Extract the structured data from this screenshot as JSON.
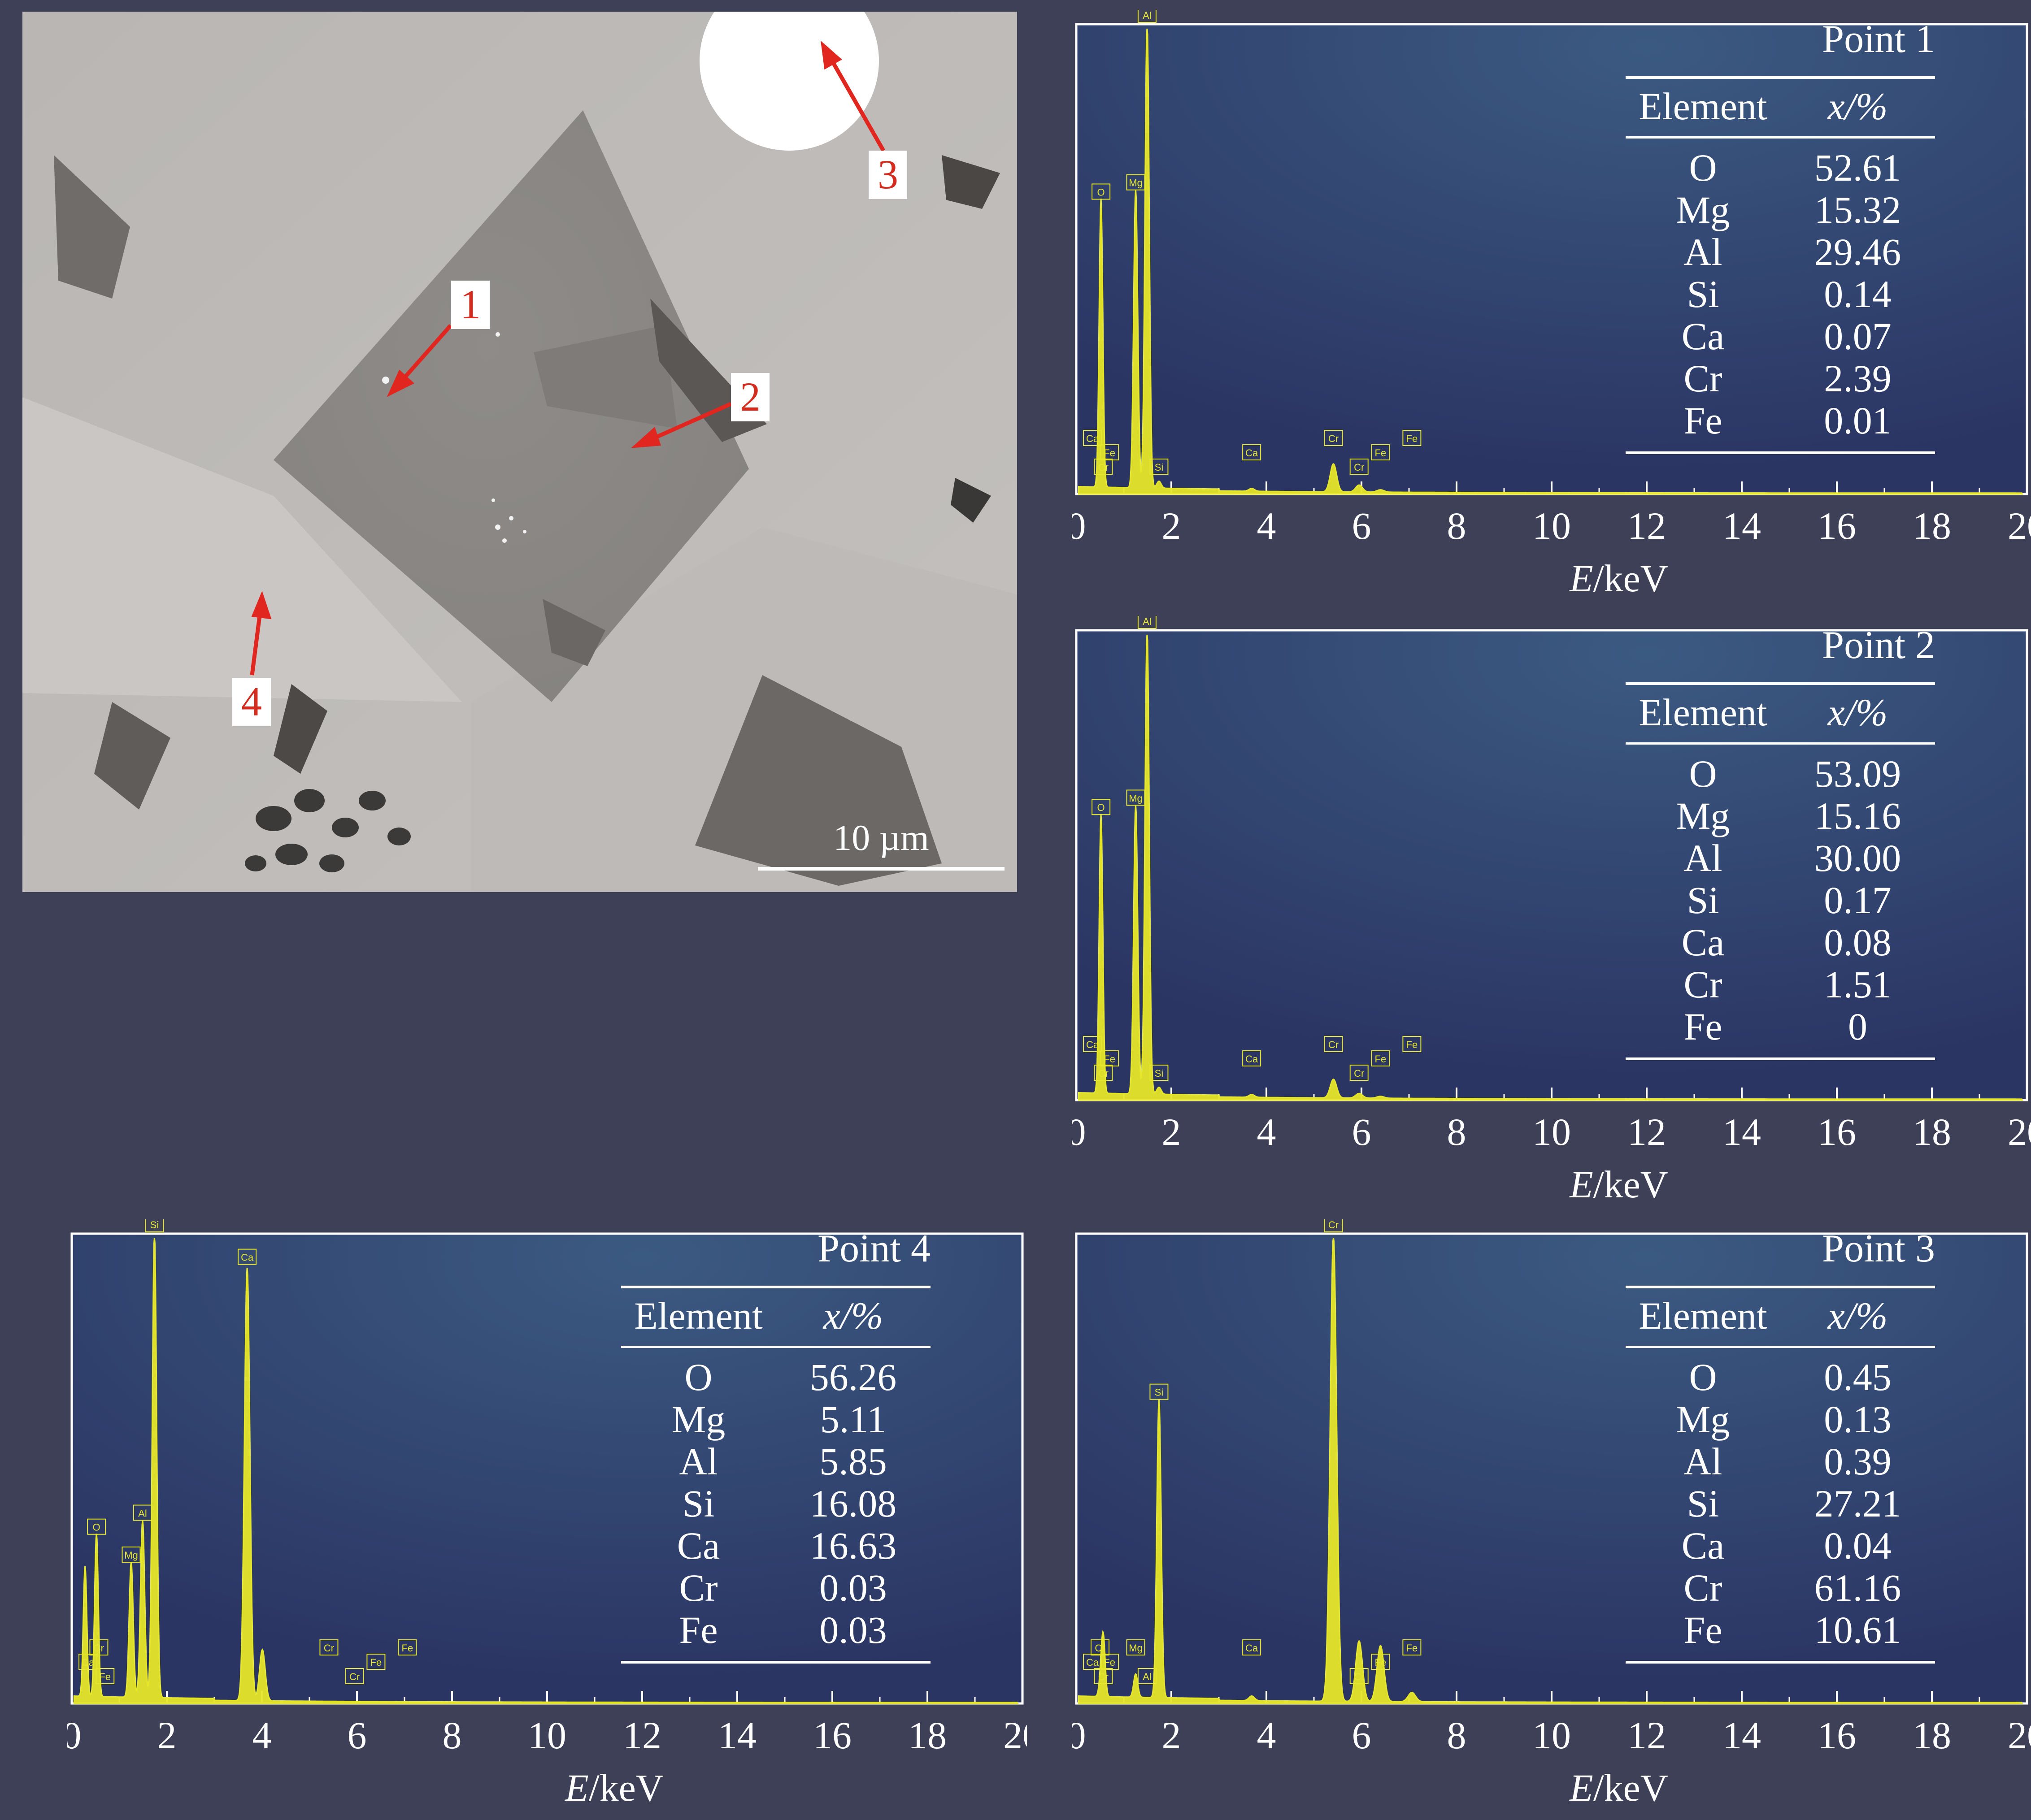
{
  "sem_image": {
    "scale_bar_label": "10 µm",
    "point_labels": [
      "1",
      "2",
      "3",
      "4"
    ]
  },
  "colors": {
    "background": "#3e4058",
    "spectrum": "#e6e62a",
    "axes": "#ffffff",
    "arrow": "#e0261e",
    "label_text": "#d42b1f"
  },
  "chart_data": [
    {
      "type": "line",
      "title": "Point 1",
      "xlabel": "E/keV",
      "xlim": [
        0,
        20
      ],
      "x_ticks": [
        "0",
        "2",
        "4",
        "6",
        "8",
        "10",
        "12",
        "14",
        "16",
        "18",
        "20"
      ],
      "peaks": [
        {
          "element": "O",
          "x": 0.52,
          "y": 62
        },
        {
          "element": "Mg",
          "x": 1.25,
          "y": 64
        },
        {
          "element": "Al",
          "x": 1.49,
          "y": 100
        },
        {
          "element": "Si",
          "x": 1.74,
          "y": 1.5
        },
        {
          "element": "Ca",
          "x": 3.69,
          "y": 0.6
        },
        {
          "element": "Cr",
          "x": 5.41,
          "y": 6
        },
        {
          "element": "Cr",
          "x": 5.95,
          "y": 1.5
        },
        {
          "element": "Fe",
          "x": 6.4,
          "y": 0.5
        }
      ],
      "peak_tags": [
        {
          "label": "Al",
          "x": 1.49
        },
        {
          "label": "Mg",
          "x": 1.25
        },
        {
          "label": "O",
          "x": 0.52
        },
        {
          "label": "Cr",
          "x": 0.57
        },
        {
          "label": "Fe",
          "x": 0.7
        },
        {
          "label": "Ca",
          "x": 0.34
        },
        {
          "label": "Si",
          "x": 1.74
        },
        {
          "label": "Ca",
          "x": 3.69
        },
        {
          "label": "Cr",
          "x": 5.41
        },
        {
          "label": "Cr",
          "x": 5.95
        },
        {
          "label": "Fe",
          "x": 6.4
        },
        {
          "label": "Fe",
          "x": 7.06
        }
      ],
      "table": {
        "headers": [
          "Element",
          "x/%"
        ],
        "rows": [
          [
            "O",
            "52.61"
          ],
          [
            "Mg",
            "15.32"
          ],
          [
            "Al",
            "29.46"
          ],
          [
            "Si",
            "0.14"
          ],
          [
            "Ca",
            "0.07"
          ],
          [
            "Cr",
            "2.39"
          ],
          [
            "Fe",
            "0.01"
          ]
        ]
      }
    },
    {
      "type": "line",
      "title": "Point 2",
      "xlabel": "E/keV",
      "xlim": [
        0,
        20
      ],
      "x_ticks": [
        "0",
        "2",
        "4",
        "6",
        "8",
        "10",
        "12",
        "14",
        "16",
        "18",
        "20"
      ],
      "peaks": [
        {
          "element": "O",
          "x": 0.52,
          "y": 60
        },
        {
          "element": "Mg",
          "x": 1.25,
          "y": 62
        },
        {
          "element": "Al",
          "x": 1.49,
          "y": 100
        },
        {
          "element": "Si",
          "x": 1.74,
          "y": 1.5
        },
        {
          "element": "Ca",
          "x": 3.69,
          "y": 0.6
        },
        {
          "element": "Cr",
          "x": 5.41,
          "y": 4
        },
        {
          "element": "Cr",
          "x": 5.95,
          "y": 1
        },
        {
          "element": "Fe",
          "x": 6.4,
          "y": 0.4
        }
      ],
      "peak_tags": [
        {
          "label": "Al",
          "x": 1.49
        },
        {
          "label": "Mg",
          "x": 1.25
        },
        {
          "label": "O",
          "x": 0.52
        },
        {
          "label": "Cr",
          "x": 0.57
        },
        {
          "label": "Fe",
          "x": 0.7
        },
        {
          "label": "Ca",
          "x": 0.34
        },
        {
          "label": "Si",
          "x": 1.74
        },
        {
          "label": "Ca",
          "x": 3.69
        },
        {
          "label": "Cr",
          "x": 5.41
        },
        {
          "label": "Cr",
          "x": 5.95
        },
        {
          "label": "Fe",
          "x": 6.4
        },
        {
          "label": "Fe",
          "x": 7.06
        }
      ],
      "table": {
        "headers": [
          "Element",
          "x/%"
        ],
        "rows": [
          [
            "O",
            "53.09"
          ],
          [
            "Mg",
            "15.16"
          ],
          [
            "Al",
            "30.00"
          ],
          [
            "Si",
            "0.17"
          ],
          [
            "Ca",
            "0.08"
          ],
          [
            "Cr",
            "1.51"
          ],
          [
            "Fe",
            "0"
          ]
        ]
      }
    },
    {
      "type": "line",
      "title": "Point 4",
      "xlabel": "E/keV",
      "xlim": [
        0,
        20
      ],
      "x_ticks": [
        "0",
        "2",
        "4",
        "6",
        "8",
        "10",
        "12",
        "14",
        "16",
        "18",
        "20"
      ],
      "peaks": [
        {
          "element": "C",
          "x": 0.28,
          "y": 28
        },
        {
          "element": "O",
          "x": 0.52,
          "y": 35
        },
        {
          "element": "Mg",
          "x": 1.25,
          "y": 29
        },
        {
          "element": "Al",
          "x": 1.49,
          "y": 38
        },
        {
          "element": "Si",
          "x": 1.74,
          "y": 100
        },
        {
          "element": "Ca",
          "x": 3.69,
          "y": 93
        },
        {
          "element": "Ca",
          "x": 4.01,
          "y": 11
        }
      ],
      "peak_tags": [
        {
          "label": "Si",
          "x": 1.74
        },
        {
          "label": "Ca",
          "x": 3.69
        },
        {
          "label": "O",
          "x": 0.52
        },
        {
          "label": "Al",
          "x": 1.49
        },
        {
          "label": "Mg",
          "x": 1.25
        },
        {
          "label": "Cr",
          "x": 0.57
        },
        {
          "label": "Fe",
          "x": 0.7
        },
        {
          "label": "Ca",
          "x": 0.34
        },
        {
          "label": "Cr",
          "x": 5.41
        },
        {
          "label": "Cr",
          "x": 5.95
        },
        {
          "label": "Fe",
          "x": 6.4
        },
        {
          "label": "Fe",
          "x": 7.06
        }
      ],
      "table": {
        "headers": [
          "Element",
          "x/%"
        ],
        "rows": [
          [
            "O",
            "56.26"
          ],
          [
            "Mg",
            "5.11"
          ],
          [
            "Al",
            "5.85"
          ],
          [
            "Si",
            "16.08"
          ],
          [
            "Ca",
            "16.63"
          ],
          [
            "Cr",
            "0.03"
          ],
          [
            "Fe",
            "0.03"
          ]
        ]
      }
    },
    {
      "type": "line",
      "title": "Point 3",
      "xlabel": "E/keV",
      "xlim": [
        0,
        20
      ],
      "x_ticks": [
        "0",
        "2",
        "4",
        "6",
        "8",
        "10",
        "12",
        "14",
        "16",
        "18",
        "20"
      ],
      "peaks": [
        {
          "element": "Cr",
          "x": 0.57,
          "y": 12
        },
        {
          "element": "O",
          "x": 0.52,
          "y": 4
        },
        {
          "element": "Mg",
          "x": 1.25,
          "y": 5
        },
        {
          "element": "Si",
          "x": 1.74,
          "y": 64
        },
        {
          "element": "Ca",
          "x": 3.69,
          "y": 1
        },
        {
          "element": "Cr",
          "x": 5.41,
          "y": 100
        },
        {
          "element": "Cr",
          "x": 5.95,
          "y": 13
        },
        {
          "element": "Fe",
          "x": 6.4,
          "y": 12
        },
        {
          "element": "Fe",
          "x": 7.06,
          "y": 2
        }
      ],
      "peak_tags": [
        {
          "label": "Cr",
          "x": 5.41
        },
        {
          "label": "Si",
          "x": 1.74
        },
        {
          "label": "Cr",
          "x": 0.5
        },
        {
          "label": "Cr",
          "x": 0.57
        },
        {
          "label": "Fe",
          "x": 0.7
        },
        {
          "label": "Mg",
          "x": 1.25
        },
        {
          "label": "Al",
          "x": 1.49
        },
        {
          "label": "Ca",
          "x": 0.34
        },
        {
          "label": "Ca",
          "x": 3.69
        },
        {
          "label": "Cr",
          "x": 5.95
        },
        {
          "label": "Fe",
          "x": 6.4
        },
        {
          "label": "Fe",
          "x": 7.06
        }
      ],
      "table": {
        "headers": [
          "Element",
          "x/%"
        ],
        "rows": [
          [
            "O",
            "0.45"
          ],
          [
            "Mg",
            "0.13"
          ],
          [
            "Al",
            "0.39"
          ],
          [
            "Si",
            "27.21"
          ],
          [
            "Ca",
            "0.04"
          ],
          [
            "Cr",
            "61.16"
          ],
          [
            "Fe",
            "10.61"
          ]
        ]
      }
    }
  ]
}
